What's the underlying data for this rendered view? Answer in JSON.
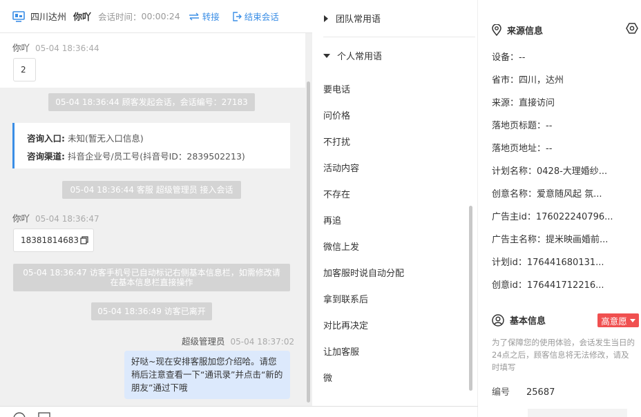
{
  "header": {
    "location": "四川达州",
    "visitor_name": "你吖",
    "session_time_label": "会话时间：",
    "session_time": "00:00:24",
    "transfer_label": "转接",
    "end_label": "结束会话",
    "accent_color": "#3a8ee6"
  },
  "chat": {
    "messages": [
      {
        "sender": "你吖",
        "time": "05-04 18:36:44",
        "text": "2"
      },
      {
        "sender": "你吖",
        "time": "05-04 18:36:47",
        "text": "18381814683"
      },
      {
        "sender": "超级管理员",
        "time": "05-04 18:37:02",
        "text": "好哒~现在安排客服加您介绍哈。请您稍后注意查看一下“通讯录”并点击“新的朋友”通过下哦"
      }
    ],
    "system_notes": [
      "05-04 18:36:44 顾客发起会话，会话编号：27183",
      "05-04 18:36:44 客服 超级管理员 接入会话",
      "05-04 18:36:47 访客手机号已自动标记右侧基本信息栏，如需修改请在基本信息栏直接操作",
      "05-04 18:36:49 访客已离开"
    ],
    "entry_card": {
      "entry_label": "咨询入口:",
      "entry_value": "未知(暂无入口信息)",
      "channel_label": "咨询渠道:",
      "channel_value": "抖音企业号/员工号(抖音号ID：2839502213)"
    }
  },
  "phrases": {
    "team_group": "团队常用语",
    "personal_group": "个人常用语",
    "items": [
      "要电话",
      "问价格",
      "不打扰",
      "活动内容",
      "不存在",
      "再追",
      "微信上发",
      "加客服时说自动分配",
      "拿到联系后",
      "对比再决定",
      "让加客服",
      "微"
    ]
  },
  "source_info": {
    "title": "来源信息",
    "fields": [
      {
        "label": "设备：",
        "value": "--"
      },
      {
        "label": "省市：",
        "value": "四川，达州"
      },
      {
        "label": "来源：",
        "value": "直接访问"
      },
      {
        "label": "落地页标题：",
        "value": "--"
      },
      {
        "label": "落地页地址：",
        "value": "--"
      },
      {
        "label": "计划名称：",
        "value": "0428-大理婚纱..."
      },
      {
        "label": "创意名称：",
        "value": "爱意随风起 氛..."
      },
      {
        "label": "广告主id：",
        "value": "176022240796..."
      },
      {
        "label": "广告主名称：",
        "value": "提米映画婚前..."
      },
      {
        "label": "计划id：",
        "value": "176441680131..."
      },
      {
        "label": "创意id：",
        "value": "176441712216..."
      }
    ]
  },
  "basic_info": {
    "title": "基本信息",
    "intent_badge": "高意愿",
    "intent_color": "#f05050",
    "notice": "为了保障您的使用体验，会话发生当日的24点之后，顾客信息将无法修改，请及时填写",
    "id_label": "编号",
    "id_value": "25687"
  },
  "icons": [
    "monitor-icon",
    "transfer-icon",
    "exit-icon",
    "copy-icon",
    "location-pin-icon",
    "settings-icon",
    "user-circle-icon",
    "emoji-icon",
    "image-icon",
    "triangle-right-icon",
    "triangle-down-icon"
  ]
}
